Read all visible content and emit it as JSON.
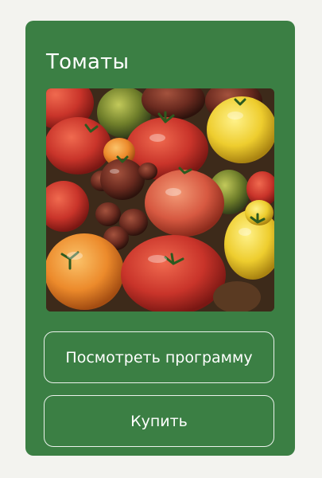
{
  "card": {
    "title": "Томаты",
    "background_color": "#3b7f44",
    "image": {
      "subject": "heirloom tomatoes",
      "alt": "Томаты"
    }
  },
  "buttons": {
    "program_label": "Посмотреть программу",
    "buy_label": "Купить"
  }
}
